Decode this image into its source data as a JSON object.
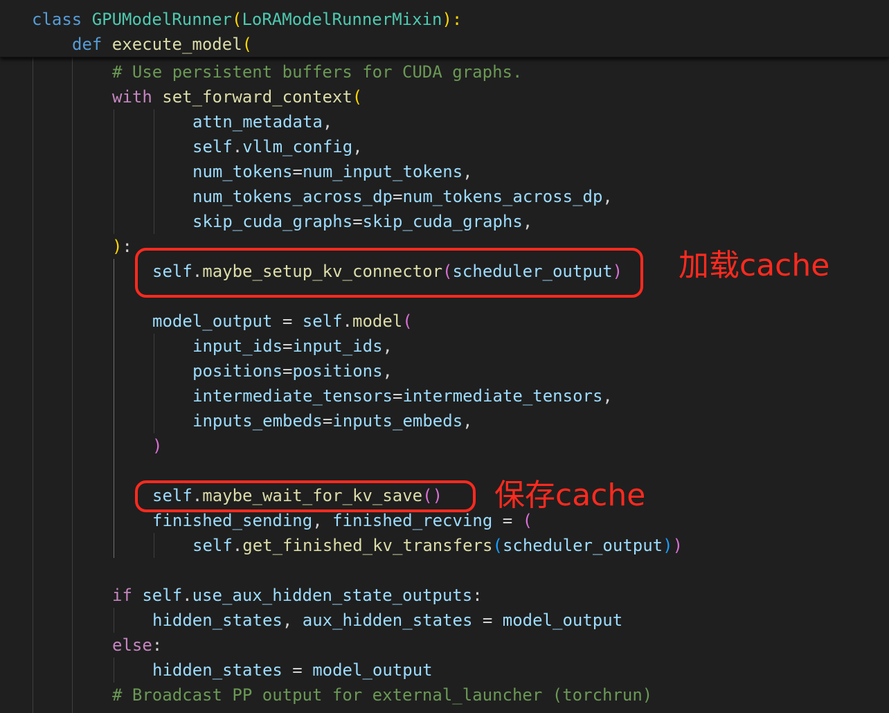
{
  "sticky": [
    [
      [
        "class ",
        "k"
      ],
      [
        "GPUModelRunner",
        "cls"
      ],
      [
        "(",
        "b1"
      ],
      [
        "LoRAModelRunnerMixin",
        "cls"
      ],
      [
        "):",
        "b1"
      ]
    ],
    [
      [
        "def ",
        "k"
      ],
      [
        "execute_model",
        "fn"
      ],
      [
        "(",
        "b1"
      ]
    ]
  ],
  "code": [
    [
      [
        "# Use persistent buffers for CUDA graphs.",
        "c"
      ]
    ],
    [
      [
        "with ",
        "kc"
      ],
      [
        "set_forward_context",
        "fn"
      ],
      [
        "(",
        "b1"
      ]
    ],
    [
      [
        "attn_metadata",
        "v"
      ],
      [
        ",",
        "p"
      ]
    ],
    [
      [
        "self",
        "v"
      ],
      [
        ".",
        "p"
      ],
      [
        "vllm_config",
        "v"
      ],
      [
        ",",
        "p"
      ]
    ],
    [
      [
        "num_tokens",
        "v"
      ],
      [
        "=",
        "p"
      ],
      [
        "num_input_tokens",
        "v"
      ],
      [
        ",",
        "p"
      ]
    ],
    [
      [
        "num_tokens_across_dp",
        "v"
      ],
      [
        "=",
        "p"
      ],
      [
        "num_tokens_across_dp",
        "v"
      ],
      [
        ",",
        "p"
      ]
    ],
    [
      [
        "skip_cuda_graphs",
        "v"
      ],
      [
        "=",
        "p"
      ],
      [
        "skip_cuda_graphs",
        "v"
      ],
      [
        ",",
        "p"
      ]
    ],
    [
      [
        ")",
        "b1"
      ],
      [
        ":",
        "p"
      ]
    ],
    [
      [
        "self",
        "v"
      ],
      [
        ".",
        "p"
      ],
      [
        "maybe_setup_kv_connector",
        "fn"
      ],
      [
        "(",
        "b2"
      ],
      [
        "scheduler_output",
        "v"
      ],
      [
        ")",
        "b2"
      ]
    ],
    [],
    [
      [
        "model_output",
        "v"
      ],
      [
        " = ",
        "p"
      ],
      [
        "self",
        "v"
      ],
      [
        ".",
        "p"
      ],
      [
        "model",
        "fn"
      ],
      [
        "(",
        "b2"
      ]
    ],
    [
      [
        "input_ids",
        "v"
      ],
      [
        "=",
        "p"
      ],
      [
        "input_ids",
        "v"
      ],
      [
        ",",
        "p"
      ]
    ],
    [
      [
        "positions",
        "v"
      ],
      [
        "=",
        "p"
      ],
      [
        "positions",
        "v"
      ],
      [
        ",",
        "p"
      ]
    ],
    [
      [
        "intermediate_tensors",
        "v"
      ],
      [
        "=",
        "p"
      ],
      [
        "intermediate_tensors",
        "v"
      ],
      [
        ",",
        "p"
      ]
    ],
    [
      [
        "inputs_embeds",
        "v"
      ],
      [
        "=",
        "p"
      ],
      [
        "inputs_embeds",
        "v"
      ],
      [
        ",",
        "p"
      ]
    ],
    [
      [
        ")",
        "b2"
      ]
    ],
    [],
    [
      [
        "self",
        "v"
      ],
      [
        ".",
        "p"
      ],
      [
        "maybe_wait_for_kv_save",
        "fn"
      ],
      [
        "()",
        "b2"
      ]
    ],
    [
      [
        "finished_sending",
        "v"
      ],
      [
        ", ",
        "p"
      ],
      [
        "finished_recving",
        "v"
      ],
      [
        " = ",
        "p"
      ],
      [
        "(",
        "b2"
      ]
    ],
    [
      [
        "self",
        "v"
      ],
      [
        ".",
        "p"
      ],
      [
        "get_finished_kv_transfers",
        "fn"
      ],
      [
        "(",
        "b3"
      ],
      [
        "scheduler_output",
        "v"
      ],
      [
        ")",
        "b3"
      ],
      [
        ")",
        "b2"
      ]
    ],
    [],
    [
      [
        "if ",
        "kc"
      ],
      [
        "self",
        "v"
      ],
      [
        ".",
        "p"
      ],
      [
        "use_aux_hidden_state_outputs",
        "v"
      ],
      [
        ":",
        "p"
      ]
    ],
    [
      [
        "hidden_states",
        "v"
      ],
      [
        ", ",
        "p"
      ],
      [
        "aux_hidden_states",
        "v"
      ],
      [
        " = ",
        "p"
      ],
      [
        "model_output",
        "v"
      ]
    ],
    [
      [
        "else",
        "kc"
      ],
      [
        ":",
        "p"
      ]
    ],
    [
      [
        "hidden_states",
        "v"
      ],
      [
        " = ",
        "p"
      ],
      [
        "model_output",
        "v"
      ]
    ],
    [
      [
        "# Broadcast PP output for external_launcher (torchrun)",
        "c"
      ]
    ]
  ],
  "annotations": {
    "load_cache": "加载cache",
    "save_cache": "保存cache"
  },
  "colors": {
    "highlight_box": "#ff2a1f",
    "background": "#1f1f1f"
  }
}
